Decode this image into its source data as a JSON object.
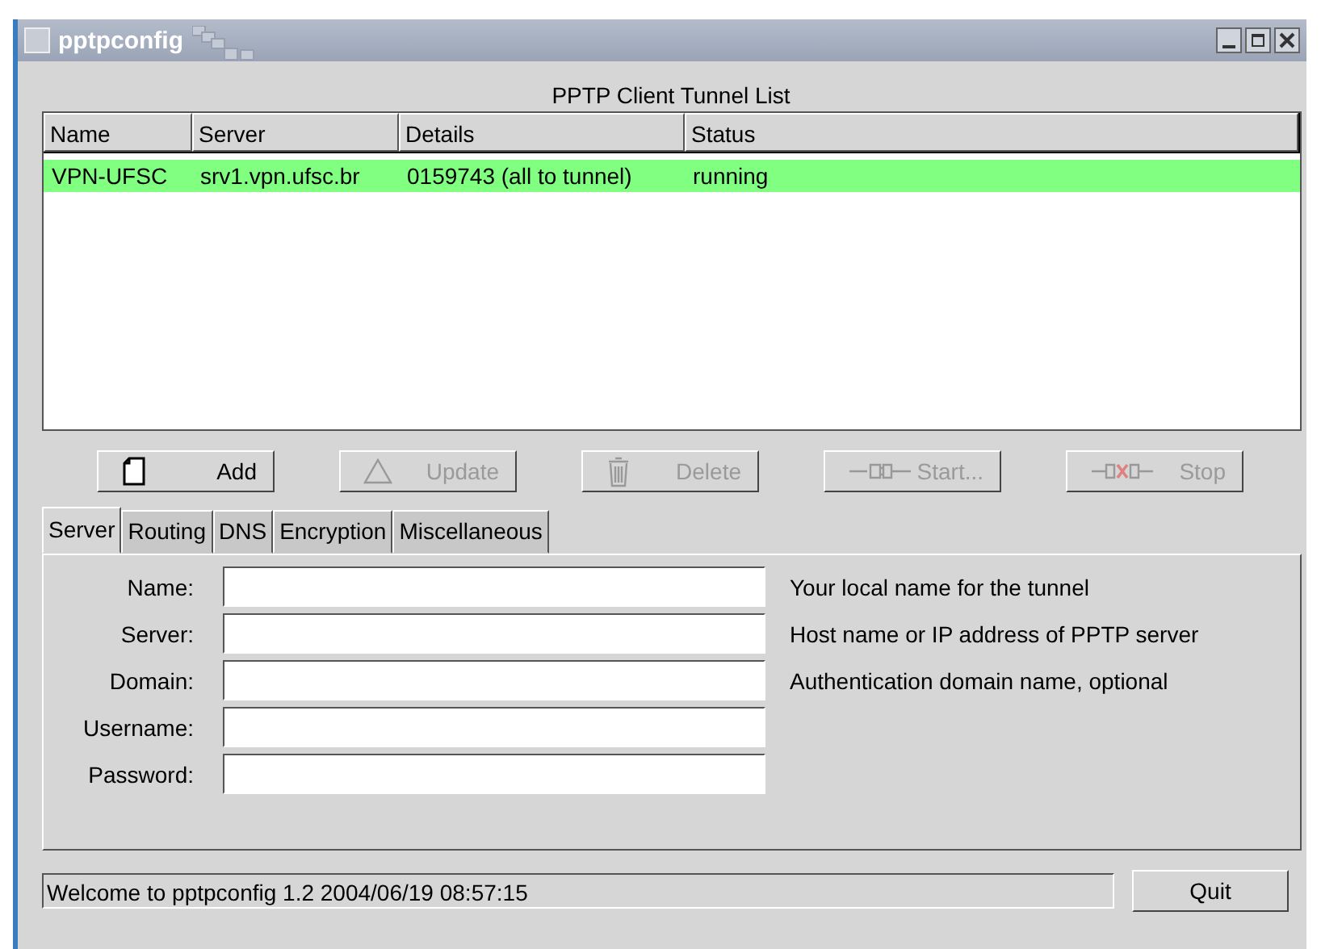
{
  "window": {
    "title": "pptpconfig"
  },
  "tunnel_list": {
    "title": "PPTP Client Tunnel List",
    "columns": [
      "Name",
      "Server",
      "Details",
      "Status"
    ],
    "rows": [
      {
        "cells": [
          "VPN-UFSC",
          "srv1.vpn.ufsc.br",
          "0159743 (all to tunnel)",
          "running"
        ],
        "selected": true
      }
    ]
  },
  "buttons": [
    {
      "kind": "add",
      "label": "Add",
      "disabled": false
    },
    {
      "kind": "update",
      "label": "Update",
      "disabled": true
    },
    {
      "kind": "delete",
      "label": "Delete",
      "disabled": true
    },
    {
      "kind": "start",
      "label": "Start...",
      "disabled": true
    },
    {
      "kind": "stop",
      "label": "Stop",
      "disabled": true
    }
  ],
  "tabs": [
    {
      "label": "Server",
      "selected": true
    },
    {
      "label": "Routing",
      "selected": false
    },
    {
      "label": "DNS",
      "selected": false
    },
    {
      "label": "Encryption",
      "selected": false
    },
    {
      "label": "Miscellaneous",
      "selected": false
    }
  ],
  "fields": [
    {
      "label": "Name:",
      "hint": "Your local name for the tunnel"
    },
    {
      "label": "Server:",
      "hint": "Host name or IP address of PPTP server"
    },
    {
      "label": "Domain:",
      "hint": "Authentication domain name, optional"
    },
    {
      "label": "Username:"
    },
    {
      "label": "Password:"
    }
  ],
  "status_bar": {
    "message": "Welcome to pptpconfig 1.2 2004/06/19 08:57:15",
    "quit": "Quit"
  }
}
